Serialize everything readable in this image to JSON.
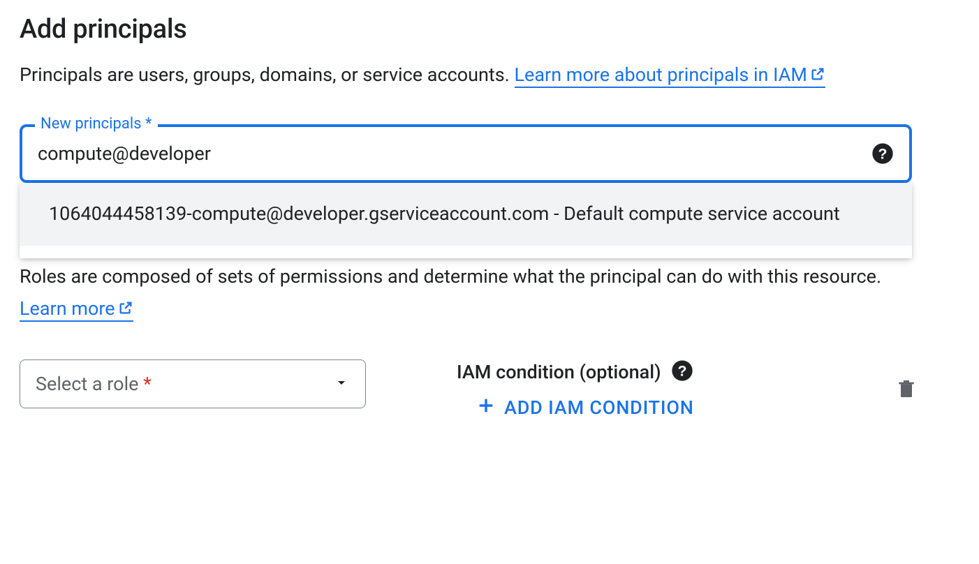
{
  "heading": "Add principals",
  "principals_description_prefix": "Principals are users, groups, domains, or service accounts. ",
  "principals_link_text": "Learn more about principals in IAM",
  "new_principals_field": {
    "label": "New principals",
    "value": "compute@developer",
    "required_marker": "*"
  },
  "autocomplete_suggestion": "1064044458139-compute@developer.gserviceaccount.com - Default compute service account",
  "roles_description_prefix": "Roles are composed of sets of permissions and determine what the principal can do with this resource. ",
  "roles_link_text": "Learn more",
  "role_select": {
    "placeholder": "Select a role",
    "required_marker": "*"
  },
  "iam_condition": {
    "title": "IAM condition (optional)",
    "add_button": "ADD IAM CONDITION"
  }
}
